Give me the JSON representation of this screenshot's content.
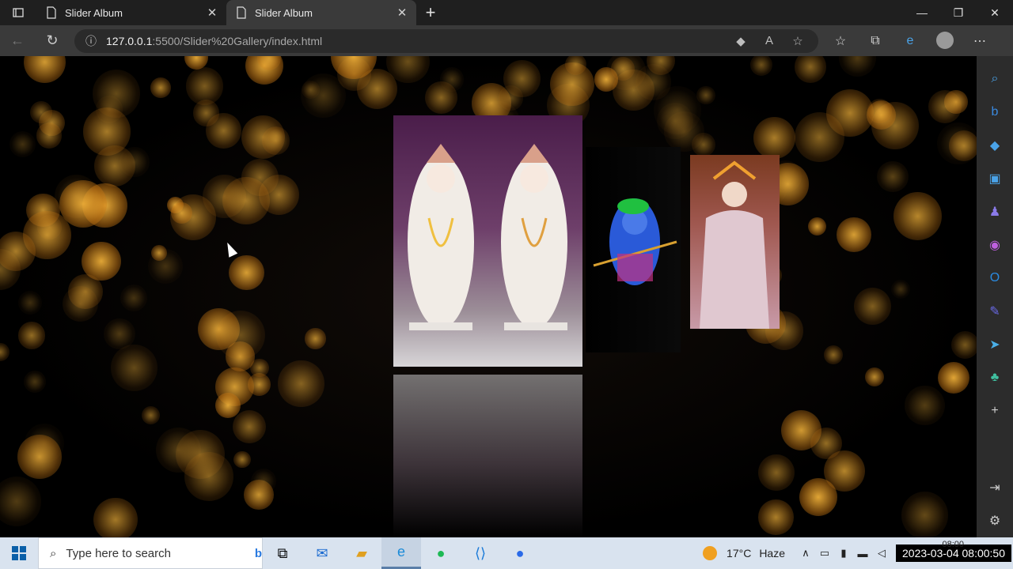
{
  "browser": {
    "tabs": [
      {
        "title": "Slider Album",
        "active": false
      },
      {
        "title": "Slider Album",
        "active": true
      }
    ],
    "url_host": "127.0.0.1",
    "url_rest": ":5500/Slider%20Gallery/index.html"
  },
  "gallery": {
    "cards": [
      "statue-photo",
      "krishna-photo",
      "radha-photo"
    ]
  },
  "taskbar": {
    "search_placeholder": "Type here to search",
    "temperature": "17°C",
    "weather": "Haze",
    "time_small": "08:00",
    "datetime": "2023-03-04 08:00:50"
  },
  "colors": {
    "bokeh": "#f2b23a",
    "page_bg": "#000000",
    "sidebar_bg": "#2c2c2c",
    "taskbar_bg": "#d9e3ef"
  }
}
